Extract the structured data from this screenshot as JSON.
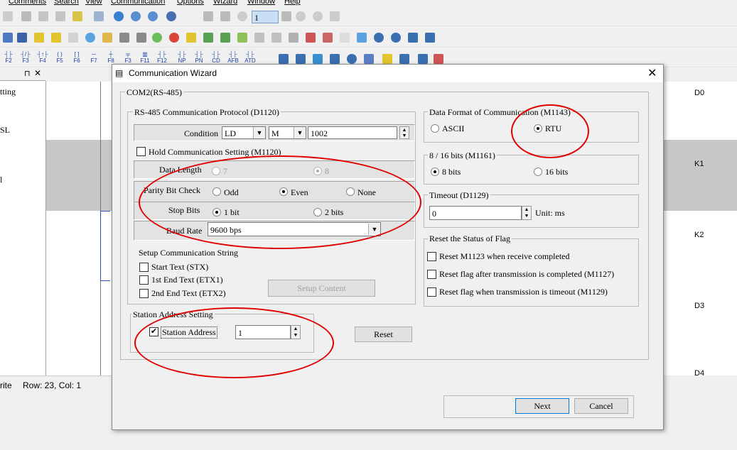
{
  "menu": [
    "Comments",
    "Search",
    "View",
    "Communication",
    "Options",
    "Wizard",
    "Window",
    "Help"
  ],
  "toolbar": {
    "step_value": "1"
  },
  "fkeys": [
    "F2",
    "F3",
    "F4",
    "F5",
    "F6",
    "F7",
    "F8",
    "F3",
    "F11",
    "F12",
    "NP",
    "PN",
    "CD",
    "AFB",
    "ATD"
  ],
  "left_panel": {
    "items": [
      "tting",
      "SL",
      "l"
    ]
  },
  "ladder_labels": [
    "D0",
    "K1",
    "K2",
    "D3",
    "D4"
  ],
  "status": {
    "mode": "rite",
    "position": "Row: 23, Col: 1"
  },
  "dialog": {
    "title": "Communication Wizard",
    "com_group": "COM2(RS-485)",
    "protocol": {
      "legend": "RS-485 Communication Protocol (D1120)",
      "condition_label": "Condition",
      "condition_op": "LD",
      "condition_dev": "M",
      "condition_value": "1002",
      "hold_label": "Hold Communication Setting (M1120)",
      "data_length_label": "Data Length",
      "dl_7": "7",
      "dl_8": "8",
      "parity_label": "Parity Bit Check",
      "parity_odd": "Odd",
      "parity_even": "Even",
      "parity_none": "None",
      "stop_label": "Stop Bits",
      "stop_1": "1 bit",
      "stop_2": "2 bits",
      "baud_label": "Baud Rate",
      "baud_value": "9600 bps"
    },
    "setup_string": {
      "legend": "Setup Communication String",
      "stx": "Start Text (STX)",
      "etx1": "1st End Text (ETX1)",
      "etx2": "2nd End Text (ETX2)",
      "setup_content": "Setup Content"
    },
    "station": {
      "legend": "Station Address Setting",
      "checkbox_label": "Station Address",
      "value": "1"
    },
    "reset_button": "Reset",
    "data_format": {
      "legend": "Data Format of Communication (M1143)",
      "ascii": "ASCII",
      "rtu": "RTU"
    },
    "bits": {
      "legend": "8 / 16 bits (M1161)",
      "b8": "8 bits",
      "b16": "16 bits"
    },
    "timeout": {
      "legend": "Timeout (D1129)",
      "value": "0",
      "unit": "Unit: ms"
    },
    "reset_flag": {
      "legend": "Reset the Status of Flag",
      "opt1": "Reset M1123 when receive completed",
      "opt2": "Reset flag after transmission is completed (M1127)",
      "opt3": "Reset flag when transmission is timeout (M1129)"
    },
    "next_button": "Next",
    "cancel_button": "Cancel"
  }
}
